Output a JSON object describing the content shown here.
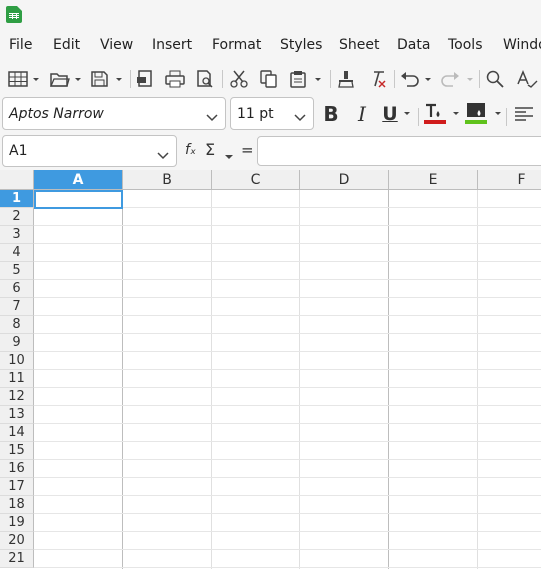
{
  "menu": [
    "File",
    "Edit",
    "View",
    "Insert",
    "Format",
    "Styles",
    "Sheet",
    "Data",
    "Tools",
    "Windo"
  ],
  "toolbar": {
    "icons": [
      "table-icon",
      "open-folder-icon",
      "save-icon",
      "export-pdf-icon",
      "print-icon",
      "print-preview-icon",
      "cut-icon",
      "copy-icon",
      "paste-icon",
      "clone-formatting-icon",
      "clear-formatting-icon",
      "undo-icon",
      "redo-icon",
      "find-replace-icon",
      "spelling-icon"
    ]
  },
  "format": {
    "font_name": "Aptos Narrow",
    "font_size": "11 pt",
    "bold_label": "B",
    "italic_label": "I",
    "underline_label": "U",
    "font_color": "#d01c1c",
    "highlight_color": "#5fc21c"
  },
  "formula": {
    "cell_ref": "A1",
    "fx": "fₓ",
    "sigma": "Σ",
    "equals": "=",
    "value": ""
  },
  "grid": {
    "columns": [
      "A",
      "B",
      "C",
      "D",
      "E",
      "F"
    ],
    "rows": [
      "1",
      "2",
      "3",
      "4",
      "5",
      "6",
      "7",
      "8",
      "9",
      "10",
      "11",
      "12",
      "13",
      "14",
      "15",
      "16",
      "17",
      "18",
      "19",
      "20",
      "21"
    ],
    "active_column": "A",
    "active_row": "1"
  }
}
